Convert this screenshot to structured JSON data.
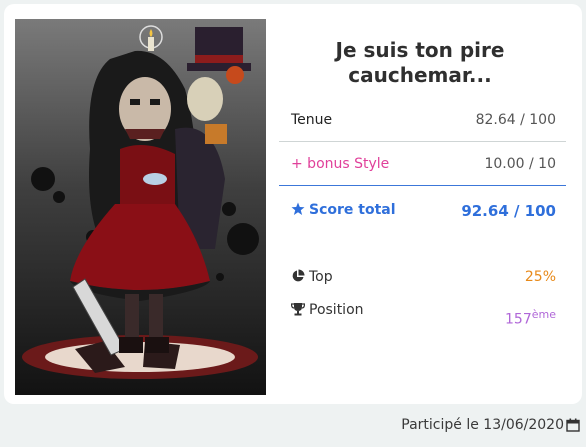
{
  "entry": {
    "title": "Je suis ton pire cauchemar...",
    "avatar_alt": "avatar"
  },
  "scores": {
    "outfit_label": "Tenue",
    "outfit_value": "82.64 / 100",
    "bonus_label": "+ bonus Style",
    "bonus_value": "10.00 / 10",
    "total_label": "Score total",
    "total_value": "92.64 / 100"
  },
  "stats": {
    "top_label": "Top",
    "top_value": "25%",
    "position_label": "Position",
    "position_value": "157",
    "position_suffix": "ème"
  },
  "footer": {
    "participated_text": "Participé le 13/06/2020"
  },
  "colors": {
    "accent_blue": "#2f6fdb",
    "pink": "#e0409a",
    "orange": "#e88a1a",
    "purple": "#b067d8"
  },
  "icons": [
    "star-icon",
    "pie-chart-icon",
    "trophy-icon",
    "calendar-icon"
  ]
}
